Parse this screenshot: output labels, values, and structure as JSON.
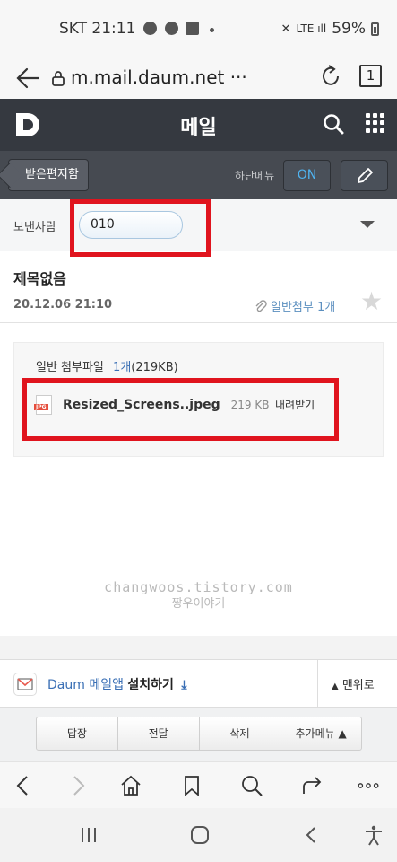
{
  "status_bar": {
    "carrier_time": "SKT 21:11",
    "battery": "59%"
  },
  "browser": {
    "url": "m.mail.daum.net ···",
    "tab_count": "1"
  },
  "header": {
    "title": "메일"
  },
  "toolbar": {
    "inbox_label": "받은편지함",
    "bottom_menu_label": "하단메뉴",
    "on_label": "ON"
  },
  "mail": {
    "sender_label": "보낸사람",
    "sender_value": "010",
    "subject": "제목없음",
    "date": "20.12.06 21:10",
    "attachment_summary": "일반첨부 1개"
  },
  "attachments": {
    "header_label": "일반 첨부파일",
    "count": "1개",
    "size_total": "(219KB)",
    "file": {
      "name": "Resized_Screens..jpeg",
      "size": "219 KB",
      "download": "내려받기",
      "type": "JPG"
    }
  },
  "watermark": {
    "line1": "changwoos.tistory.com",
    "line2": "짱우이야기"
  },
  "app_banner": {
    "brand": "Daum 메일앱",
    "action": "설치하기",
    "to_top": "맨위로"
  },
  "actions": [
    "답장",
    "전달",
    "삭제",
    "추가메뉴 ▲"
  ]
}
